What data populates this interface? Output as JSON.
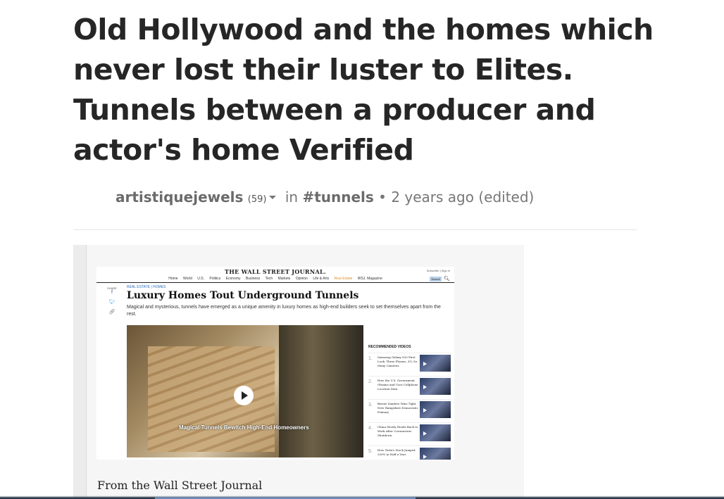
{
  "post": {
    "title": "Old Hollywood and the homes which never lost their luster to Elites. Tunnels between a producer and actor's home Verified",
    "author": "artistiquejewels",
    "reputation": "(59)",
    "in_label": "in",
    "tag": "#tunnels",
    "separator": "•",
    "time": "2 years ago",
    "edited": "(edited)"
  },
  "embed": {
    "masthead": "THE WALL STREET JOURNAL.",
    "subscribe": "Subscribe  |  Sign in",
    "search_label": "Search",
    "nav": [
      "Home",
      "World",
      "U.S.",
      "Politics",
      "Economy",
      "Business",
      "Tech",
      "Markets",
      "Opinion",
      "Life & Arts",
      "Real Estate",
      "WSJ. Magazine"
    ],
    "share_label": "SHARE",
    "kicker": "REAL ESTATE  |  HOMES",
    "headline": "Luxury Homes Tout Underground Tunnels",
    "dek": "Magical and mysterious, tunnels have emerged as a unique amenity in luxury homes as high-end builders seek to set themselves apart from the rest.",
    "photo_caption": "Magical Tunnels Bewitch High-End Homeowners",
    "recommended_heading": "RECOMMENDED VIDEOS",
    "videos": [
      {
        "num": "1.",
        "title": "Samsung Galaxy S20 First Look: Three Phones, 5G, So Many Cameras"
      },
      {
        "num": "2.",
        "title": "How the U.S. Government Obtains and Uses Cellphone Location Data"
      },
      {
        "num": "3.",
        "title": "Bernie Sanders Wins Tight New Hampshire Democratic Primary"
      },
      {
        "num": "4.",
        "title": "China Slowly Heads Back to Work After Coronavirus Shutdown"
      },
      {
        "num": "5.",
        "title": "How Tesla's Stock Jumped 200% in Half a Year"
      }
    ]
  },
  "caption": "From the Wall Street Journal"
}
